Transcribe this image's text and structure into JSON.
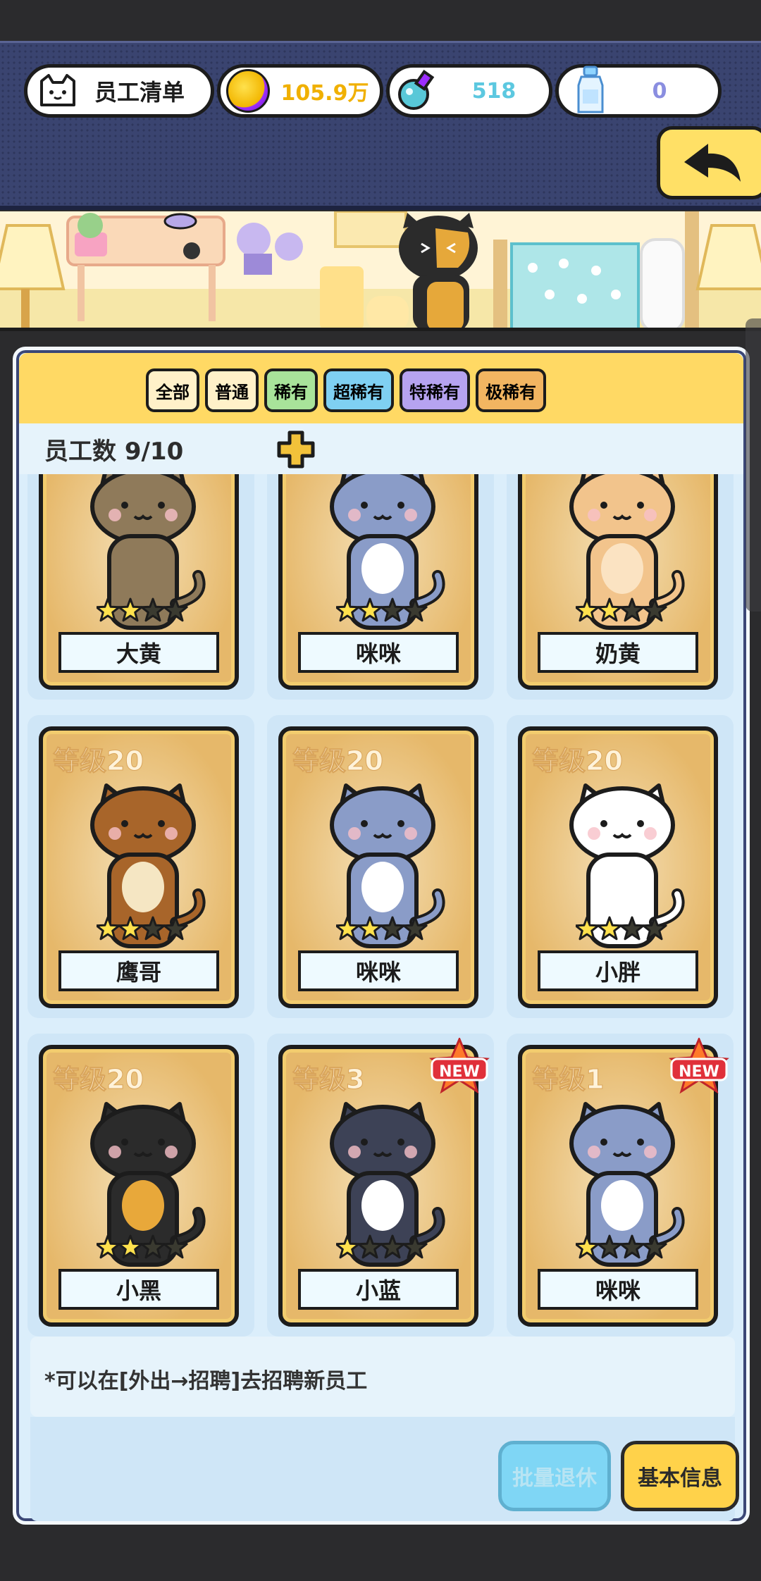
{
  "header": {
    "title": "员工清单",
    "title_icon": "cat-face-icon",
    "coins": "105.9万",
    "gems": "518",
    "bottles": "0",
    "colors": {
      "coin": "#f2b600",
      "gem": "#5cc8e0",
      "bottle": "#8a8ee0"
    }
  },
  "tabs": [
    {
      "label": "全部",
      "color": "#fff1c9"
    },
    {
      "label": "普通",
      "color": "#fff1c9"
    },
    {
      "label": "稀有",
      "color": "#a8e39a"
    },
    {
      "label": "超稀有",
      "color": "#7fd0f2"
    },
    {
      "label": "特稀有",
      "color": "#b6a3f0"
    },
    {
      "label": "极稀有",
      "color": "#f2b561"
    }
  ],
  "count": {
    "label": "员工数 9/10"
  },
  "employees": [
    {
      "name": "大黄",
      "level": "",
      "stars": 2,
      "is_new": false,
      "fur": "#8f7a5a",
      "belly": "#8f7a5a"
    },
    {
      "name": "咪咪",
      "level": "",
      "stars": 2,
      "is_new": false,
      "fur": "#8a9cc8",
      "belly": "#ffffff"
    },
    {
      "name": "奶黄",
      "level": "",
      "stars": 2,
      "is_new": false,
      "fur": "#f2c48c",
      "belly": "#fbe3c2"
    },
    {
      "name": "鹰哥",
      "level": "等级20",
      "stars": 2,
      "is_new": false,
      "fur": "#a8652a",
      "belly": "#f5e6c3"
    },
    {
      "name": "咪咪",
      "level": "等级20",
      "stars": 2,
      "is_new": false,
      "fur": "#8a9cc8",
      "belly": "#ffffff"
    },
    {
      "name": "小胖",
      "level": "等级20",
      "stars": 2,
      "is_new": false,
      "fur": "#ffffff",
      "belly": "#ffffff"
    },
    {
      "name": "小黑",
      "level": "等级20",
      "stars": 2,
      "is_new": false,
      "fur": "#2b2b2b",
      "belly": "#e8a83a"
    },
    {
      "name": "小蓝",
      "level": "等级3",
      "stars": 1,
      "is_new": true,
      "fur": "#3d4256",
      "belly": "#ffffff"
    },
    {
      "name": "咪咪",
      "level": "等级1",
      "stars": 1,
      "is_new": true,
      "fur": "#8a9cc8",
      "belly": "#ffffff"
    }
  ],
  "new_label": "NEW",
  "hint": "*可以在[外出→招聘]去招聘新员工",
  "buttons": {
    "retire": "批量退休",
    "info": "基本信息"
  }
}
